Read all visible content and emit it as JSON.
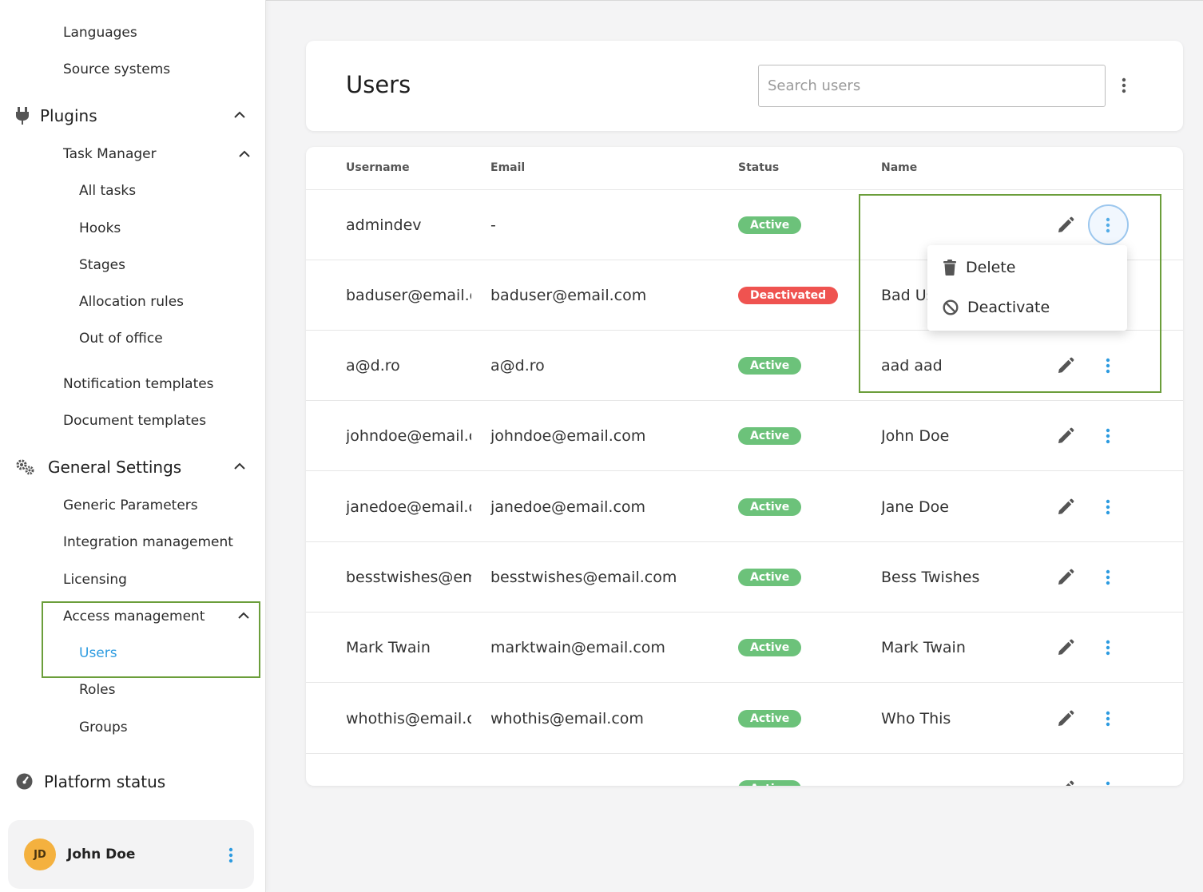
{
  "sidebar": {
    "items_top": {
      "languages": "Languages",
      "source_systems": "Source systems"
    },
    "plugins": {
      "label": "Plugins",
      "task_manager": {
        "label": "Task Manager",
        "children": {
          "all_tasks": "All tasks",
          "hooks": "Hooks",
          "stages": "Stages",
          "allocation_rules": "Allocation rules",
          "out_of_office": "Out of office"
        }
      },
      "notification_templates": "Notification templates",
      "document_templates": "Document templates"
    },
    "general_settings": {
      "label": "General Settings",
      "generic_parameters": "Generic Parameters",
      "integration_management": "Integration management",
      "licensing": "Licensing",
      "access_management": {
        "label": "Access management",
        "children": {
          "users": "Users",
          "roles": "Roles",
          "groups": "Groups"
        }
      }
    },
    "platform_status": "Platform status",
    "user": {
      "initials": "JD",
      "name": "John Doe"
    }
  },
  "header": {
    "title": "Users",
    "search_placeholder": "Search users"
  },
  "table": {
    "columns": {
      "username": "Username",
      "email": "Email",
      "status": "Status",
      "name": "Name"
    },
    "rows": [
      {
        "username": "admindev",
        "email": "-",
        "status": "Active",
        "name": ""
      },
      {
        "username": "baduser@email.c",
        "email": "baduser@email.com",
        "status": "Deactivated",
        "name": "Bad Us"
      },
      {
        "username": "a@d.ro",
        "email": "a@d.ro",
        "status": "Active",
        "name": "aad aad"
      },
      {
        "username": "johndoe@email.c",
        "email": "johndoe@email.com",
        "status": "Active",
        "name": "John Doe"
      },
      {
        "username": "janedoe@email.c",
        "email": "janedoe@email.com",
        "status": "Active",
        "name": "Jane Doe"
      },
      {
        "username": "besstwishes@em",
        "email": "besstwishes@email.com",
        "status": "Active",
        "name": "Bess Twishes"
      },
      {
        "username": "Mark Twain",
        "email": "marktwain@email.com",
        "status": "Active",
        "name": "Mark Twain"
      },
      {
        "username": "whothis@email.c",
        "email": "whothis@email.com",
        "status": "Active",
        "name": "Who This"
      },
      {
        "username": "",
        "email": "",
        "status": "Active",
        "name": ""
      }
    ]
  },
  "row_menu": {
    "delete": "Delete",
    "deactivate": "Deactivate"
  },
  "colors": {
    "active": "#6cc27a",
    "deactivated": "#ef5350",
    "accent": "#2d9be0",
    "highlight": "#6b9e3b",
    "avatar": "#f4b13f"
  },
  "icons": {
    "plugins": "plug-icon",
    "general_settings": "gears-icon",
    "platform_status": "gauge-icon",
    "edit": "pencil-icon",
    "more": "more-vertical-icon",
    "delete": "trash-icon",
    "deactivate": "block-icon"
  }
}
